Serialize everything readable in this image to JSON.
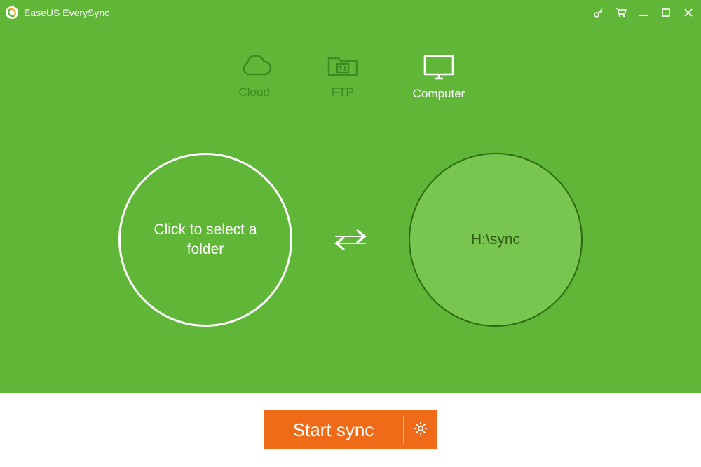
{
  "window": {
    "title": "EaseUS EverySync"
  },
  "tabs": {
    "cloud": {
      "label": "Cloud"
    },
    "ftp": {
      "label": "FTP"
    },
    "computer": {
      "label": "Computer"
    },
    "active": "computer"
  },
  "source": {
    "placeholder": "Click to select a folder"
  },
  "target": {
    "path": "H:\\sync"
  },
  "actions": {
    "start_label": "Start sync"
  },
  "icons": {
    "cloud": "cloud-icon",
    "ftp": "ftp-folder-icon",
    "computer": "monitor-icon",
    "swap": "swap-arrows-icon",
    "settings": "gear-icon",
    "activate": "key-icon",
    "cart": "cart-icon",
    "minimize": "minimize-icon",
    "maximize": "maximize-icon",
    "close": "close-icon"
  },
  "colors": {
    "brand_green": "#5fb637",
    "dark_green": "#3b8c20",
    "circle_fill": "#78c64f",
    "circle_stroke": "#2b6a12",
    "orange": "#ef6b17"
  }
}
